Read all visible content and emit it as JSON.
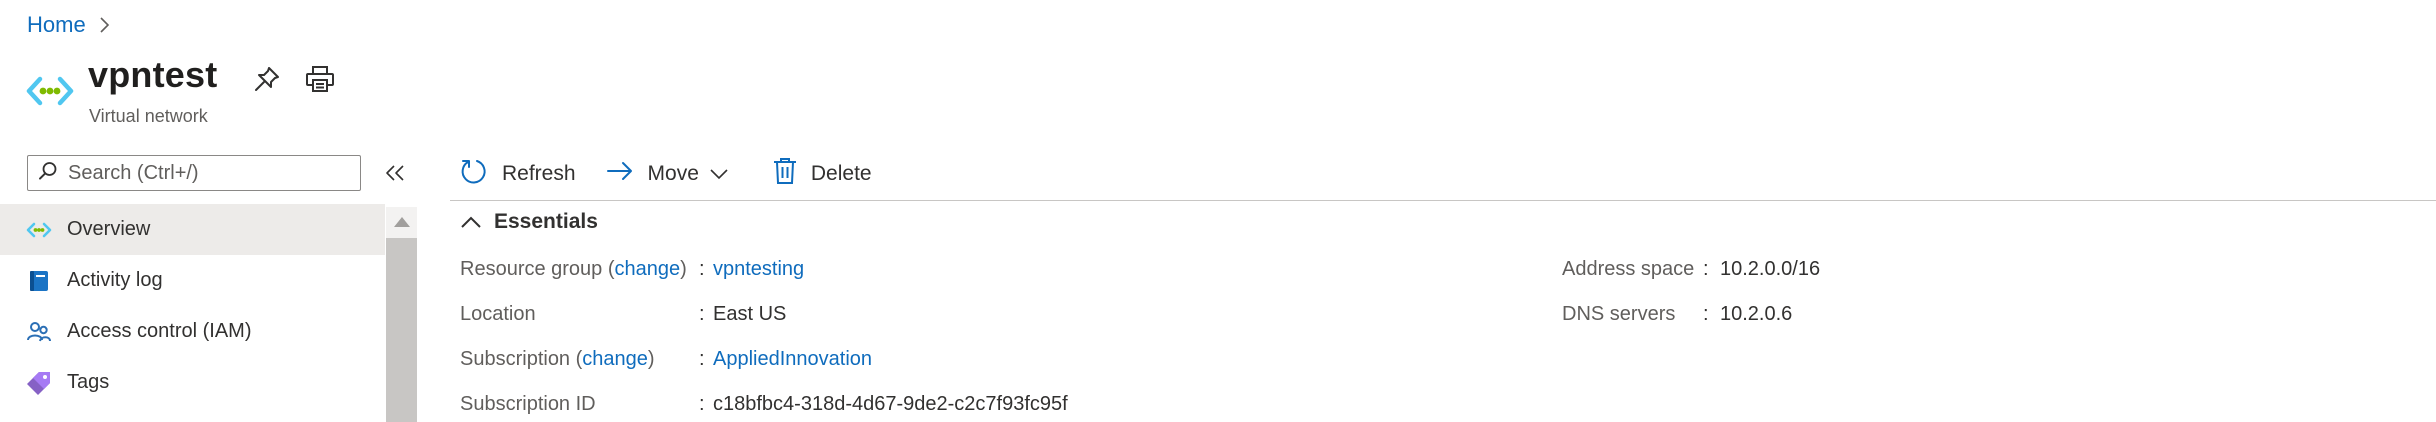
{
  "breadcrumb": {
    "home": "Home"
  },
  "resource": {
    "name": "vpntest",
    "type": "Virtual network",
    "icon": "virtual-network-icon"
  },
  "search": {
    "placeholder": "Search (Ctrl+/)",
    "value": ""
  },
  "sidebar": {
    "items": [
      {
        "label": "Overview",
        "icon": "virtual-network-icon",
        "active": true
      },
      {
        "label": "Activity log",
        "icon": "activity-log-icon",
        "active": false
      },
      {
        "label": "Access control (IAM)",
        "icon": "people-icon",
        "active": false
      },
      {
        "label": "Tags",
        "icon": "tag-icon",
        "active": false
      }
    ]
  },
  "toolbar": {
    "refresh": "Refresh",
    "move": "Move",
    "delete": "Delete"
  },
  "essentials": {
    "title": "Essentials",
    "left": [
      {
        "label": "Resource group",
        "change": "change",
        "value": "vpntesting",
        "is_link": true
      },
      {
        "label": "Location",
        "value": "East US",
        "is_link": false
      },
      {
        "label": "Subscription",
        "change": "change",
        "value": "AppliedInnovation",
        "is_link": true
      },
      {
        "label": "Subscription ID",
        "value": "c18bfbc4-318d-4d67-9de2-c2c7f93fc95f",
        "is_link": false
      }
    ],
    "right": [
      {
        "label": "Address space",
        "value": "10.2.0.0/16"
      },
      {
        "label": "DNS servers",
        "value": "10.2.0.6"
      }
    ]
  },
  "colors": {
    "link": "#0f6cbd",
    "active_bg": "#edebe9",
    "vnet_green": "#7fba00",
    "vnet_blue": "#50c7f0"
  }
}
